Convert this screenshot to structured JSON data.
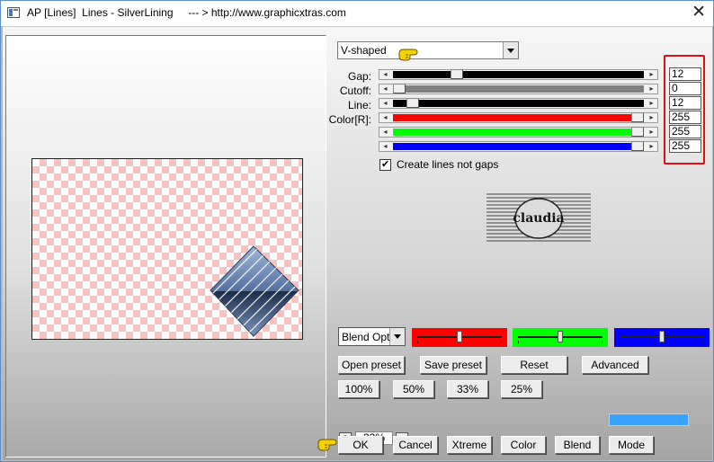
{
  "window": {
    "title": "AP [Lines]  Lines - SilverLining     --- > http://www.graphicxtras.com",
    "close_glyph": "✕"
  },
  "mode_select": {
    "value": "V-shaped"
  },
  "sliders": [
    {
      "label": "Gap:",
      "value": "12",
      "track_color": "#000000",
      "fill": 0.26
    },
    {
      "label": "Cutoff:",
      "value": "0",
      "track_color": "#808080",
      "fill": 0.0
    },
    {
      "label": "Line:",
      "value": "12",
      "track_color": "#000000",
      "fill": 0.06
    },
    {
      "label": "Color[R]:",
      "value": "255",
      "track_color": "#ff0000",
      "fill": 1.0
    },
    {
      "label": "",
      "value": "255",
      "track_color": "#00ff00",
      "fill": 1.0
    },
    {
      "label": "",
      "value": "255",
      "track_color": "#0000ff",
      "fill": 1.0
    }
  ],
  "checkbox": {
    "label": "Create lines not gaps",
    "checked": true
  },
  "logo_text": "claudia",
  "blend_select": {
    "value": "Blend Optio"
  },
  "color_sliders": [
    {
      "color": "#ff0000",
      "knob": 0.5
    },
    {
      "color": "#00ff00",
      "knob": 0.5
    },
    {
      "color": "#0000ff",
      "knob": 0.5
    }
  ],
  "buttons": {
    "open_preset": "Open preset",
    "save_preset": "Save preset",
    "reset": "Reset",
    "advanced": "Advanced",
    "zoom_100": "100%",
    "zoom_50": "50%",
    "zoom_33": "33%",
    "zoom_25": "25%",
    "ok": "OK",
    "cancel": "Cancel",
    "xtreme": "Xtreme",
    "color": "Color",
    "blend": "Blend",
    "mode": "Mode"
  },
  "zoom": {
    "plus": "+",
    "value": "33%",
    "minus": "−"
  },
  "current_color": "#3aa3ff",
  "icons": [
    "app-icon",
    "close-icon",
    "pointing-hand-icon",
    "dropdown-arrow-icon",
    "checkmark-icon"
  ]
}
